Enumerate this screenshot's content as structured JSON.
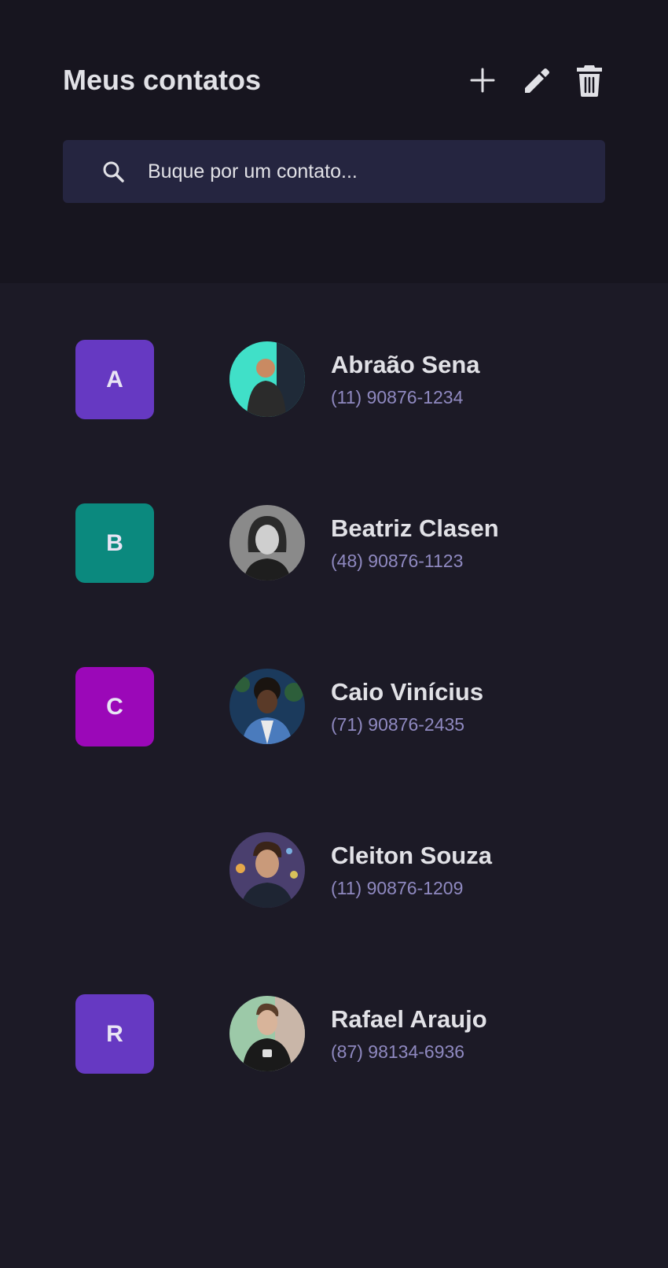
{
  "header": {
    "title": "Meus contatos",
    "actions": [
      {
        "icon": "plus-icon",
        "label": "add"
      },
      {
        "icon": "pencil-icon",
        "label": "edit"
      },
      {
        "icon": "trash-icon",
        "label": "delete"
      }
    ]
  },
  "search": {
    "placeholder": "Buque por um contato...",
    "value": "",
    "icon": "search-icon"
  },
  "colors": {
    "header_bg": "#17151f",
    "page_bg": "#1c1a26",
    "search_bg": "#252540",
    "text": "#e1e1e6",
    "phone_text": "#8f89c0"
  },
  "contacts": [
    {
      "letter": "A",
      "letter_color": "#6639c2",
      "name": "Abraão Sena",
      "phone": "(11) 90876-1234",
      "avatar_colors": [
        "#40e0c8",
        "#2b2b2b",
        "#c98a62"
      ]
    },
    {
      "letter": "B",
      "letter_color": "#0b897e",
      "name": "Beatriz Clasen",
      "phone": "(48) 90876-1123",
      "avatar_colors": [
        "#8a8a8a",
        "#2a2a2a",
        "#cfcfcf"
      ]
    },
    {
      "letter": "C",
      "letter_color": "#9b08b8",
      "name": "Caio Vinícius",
      "phone": "(71) 90876-2435",
      "avatar_colors": [
        "#1b3a5c",
        "#3b2a20",
        "#4a7bbd"
      ]
    },
    {
      "letter": "",
      "letter_color": "",
      "name": "Cleiton Souza",
      "phone": "(11) 90876-1209",
      "avatar_colors": [
        "#4a3f6e",
        "#1e2533",
        "#c99a7a"
      ]
    },
    {
      "letter": "R",
      "letter_color": "#6639c2",
      "name": "Rafael Araujo",
      "phone": "(87) 98134-6936",
      "avatar_colors": [
        "#9cc9a8",
        "#1a1a1a",
        "#d8b49a"
      ]
    }
  ]
}
